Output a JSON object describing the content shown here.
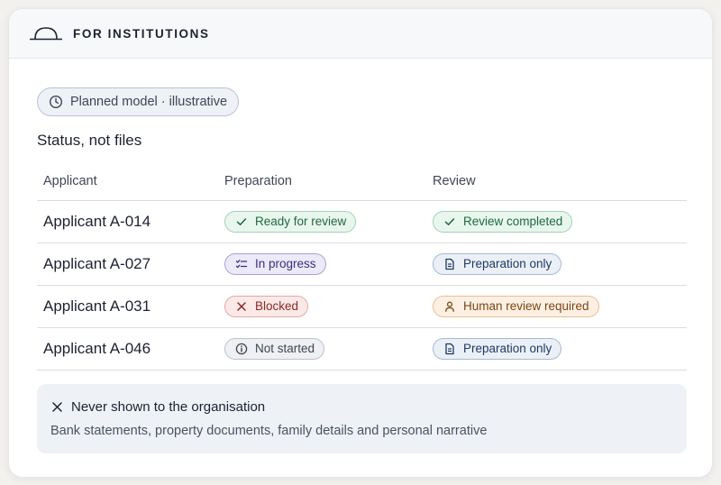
{
  "header": {
    "title": "FOR INSTITUTIONS",
    "logo_icon": "dome-logo"
  },
  "planned_chip": {
    "label": "Planned model · illustrative",
    "icon": "clock-icon"
  },
  "section_title": "Status, not files",
  "table": {
    "columns": [
      "Applicant",
      "Preparation",
      "Review"
    ],
    "rows": [
      {
        "applicant": "Applicant A-014",
        "preparation": {
          "label": "Ready for review",
          "icon": "check-icon",
          "tone": "green"
        },
        "review": {
          "label": "Review completed",
          "icon": "check-icon",
          "tone": "green"
        }
      },
      {
        "applicant": "Applicant A-027",
        "preparation": {
          "label": "In progress",
          "icon": "checklist-icon",
          "tone": "purple"
        },
        "review": {
          "label": "Preparation only",
          "icon": "document-icon",
          "tone": "blue"
        }
      },
      {
        "applicant": "Applicant A-031",
        "preparation": {
          "label": "Blocked",
          "icon": "close-icon",
          "tone": "red"
        },
        "review": {
          "label": "Human review required",
          "icon": "person-icon",
          "tone": "orange"
        }
      },
      {
        "applicant": "Applicant A-046",
        "preparation": {
          "label": "Not started",
          "icon": "info-icon",
          "tone": "gray"
        },
        "review": {
          "label": "Preparation only",
          "icon": "document-icon",
          "tone": "blue"
        }
      }
    ]
  },
  "notice": {
    "title": "Never shown to the organisation",
    "icon": "close-icon",
    "text": "Bank statements, property documents, family details and personal narrative"
  },
  "colors": {
    "green": "#1e6a3d",
    "purple": "#3b2f7a",
    "red": "#8a2a25",
    "blue": "#1f3a63",
    "orange": "#7a4614",
    "gray": "#3e4552"
  }
}
